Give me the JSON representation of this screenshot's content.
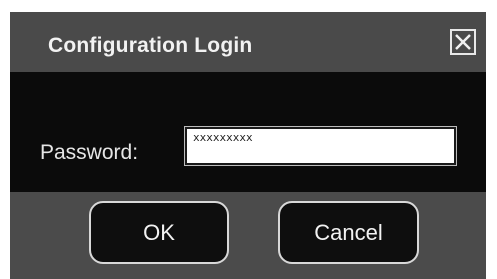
{
  "dialog": {
    "title": "Configuration Login",
    "close_icon": "close-icon"
  },
  "form": {
    "password_label": "Password:",
    "password_value": "xxxxxxxxx"
  },
  "buttons": {
    "ok_label": "OK",
    "cancel_label": "Cancel"
  },
  "colors": {
    "titlebar": "#4a4a4a",
    "body": "#0b0b0b",
    "button_bar": "#4b4b4b",
    "text": "#f2f2f2"
  }
}
